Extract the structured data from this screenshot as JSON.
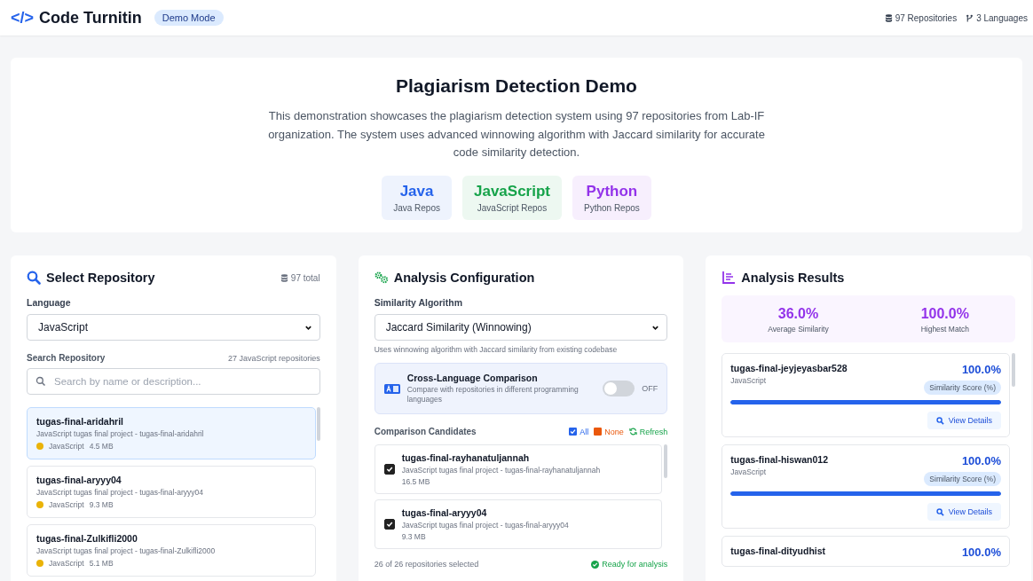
{
  "header": {
    "logo": "</>",
    "title": "Code Turnitin",
    "badge": "Demo Mode",
    "stats": [
      {
        "kind": "database",
        "label": "97 Repositories"
      },
      {
        "kind": "branch",
        "label": "3 Languages"
      }
    ]
  },
  "hero": {
    "title": "Plagiarism Detection Demo",
    "description": "This demonstration showcases the plagiarism detection system using 97 repositories from Lab-IF organization. The system uses advanced winnowing algorithm with Jaccard similarity for accurate code similarity detection.",
    "languages": [
      {
        "name": "Java",
        "label": "Java Repos",
        "color": "#2563eb"
      },
      {
        "name": "JavaScript",
        "label": "JavaScript Repos",
        "color": "#16a34a"
      },
      {
        "name": "Python",
        "label": "Python Repos",
        "color": "#9333ea"
      }
    ]
  },
  "select_panel": {
    "title": "Select Repository",
    "count": "97 total",
    "language_label": "Language",
    "language_value": "JavaScript",
    "search_label": "Search Repository",
    "search_count": "27 JavaScript repositories",
    "search_placeholder": "Search by name or description...",
    "repos": [
      {
        "name": "tugas-final-aridahril",
        "description": "JavaScript tugas final project - tugas-final-aridahril",
        "language": "JavaScript",
        "size": "4.5 MB",
        "selected": true,
        "color": "#eab308"
      },
      {
        "name": "tugas-final-aryyy04",
        "description": "JavaScript tugas final project - tugas-final-aryyy04",
        "language": "JavaScript",
        "size": "9.3 MB",
        "selected": false,
        "color": "#eab308"
      },
      {
        "name": "tugas-final-Zulkifli2000",
        "description": "JavaScript tugas final project - tugas-final-Zulkifli2000",
        "language": "JavaScript",
        "size": "5.1 MB",
        "selected": false,
        "color": "#eab308"
      }
    ]
  },
  "config_panel": {
    "title": "Analysis Configuration",
    "algorithm_label": "Similarity Algorithm",
    "algorithm_value": "Jaccard Similarity (Winnowing)",
    "algorithm_hint": "Uses winnowing algorithm with Jaccard similarity from existing codebase",
    "cross_language": {
      "title": "Cross-Language Comparison",
      "description": "Compare with repositories in different programming languages",
      "on": false,
      "state_label": "OFF"
    },
    "candidates_label": "Comparison Candidates",
    "actions": [
      {
        "kind": "all",
        "label": "All"
      },
      {
        "kind": "none",
        "label": "None"
      },
      {
        "kind": "refresh",
        "label": "Refresh"
      }
    ],
    "candidates": [
      {
        "name": "tugas-final-rayhanatuljannah",
        "description": "JavaScript tugas final project - tugas-final-rayhanatuljannah",
        "size": "16.5 MB",
        "checked": true
      },
      {
        "name": "tugas-final-aryyy04",
        "description": "JavaScript tugas final project - tugas-final-aryyy04",
        "size": "9.3 MB",
        "checked": true
      }
    ],
    "footer_count": "26 of 26 repositories selected",
    "footer_status": "Ready for analysis"
  },
  "results_panel": {
    "title": "Analysis Results",
    "summary": [
      {
        "value": "36.0%",
        "label": "Average Similarity"
      },
      {
        "value": "100.0%",
        "label": "Highest Match"
      }
    ],
    "items": [
      {
        "name": "tugas-final-jeyjeyasbar528",
        "language": "JavaScript",
        "score": "100.0%",
        "badge": "Similarity Score (%)",
        "level": 1,
        "button": "View Details"
      },
      {
        "name": "tugas-final-hiswan012",
        "language": "JavaScript",
        "score": "100.0%",
        "badge": "Similarity Score (%)",
        "level": 1,
        "button": "View Details"
      },
      {
        "name": "tugas-final-dityudhist",
        "score": "100.0%"
      }
    ]
  }
}
